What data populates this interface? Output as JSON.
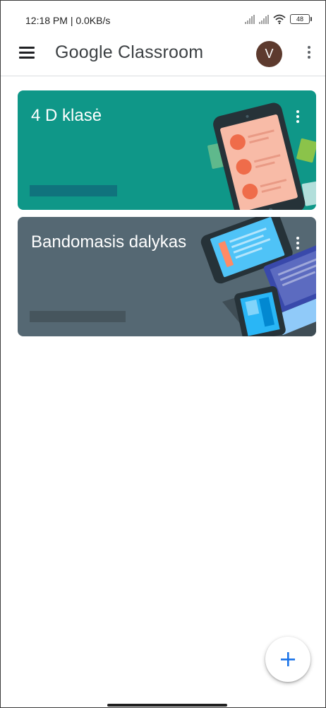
{
  "status_bar": {
    "time": "12:18 PM | 0.0KB/s",
    "battery": "48"
  },
  "app_bar": {
    "title": "Google Classroom",
    "avatar_initial": "V"
  },
  "classes": [
    {
      "name": "4 D klasė",
      "color": "#0f9788"
    },
    {
      "name": "Bandomasis dalykas",
      "color": "#556873"
    }
  ],
  "fab": {
    "icon": "plus-icon",
    "color": "#1a73e8"
  },
  "icons": [
    "menu-icon",
    "more-vert-icon",
    "plus-icon",
    "wifi-icon",
    "signal-icon",
    "battery-icon"
  ]
}
